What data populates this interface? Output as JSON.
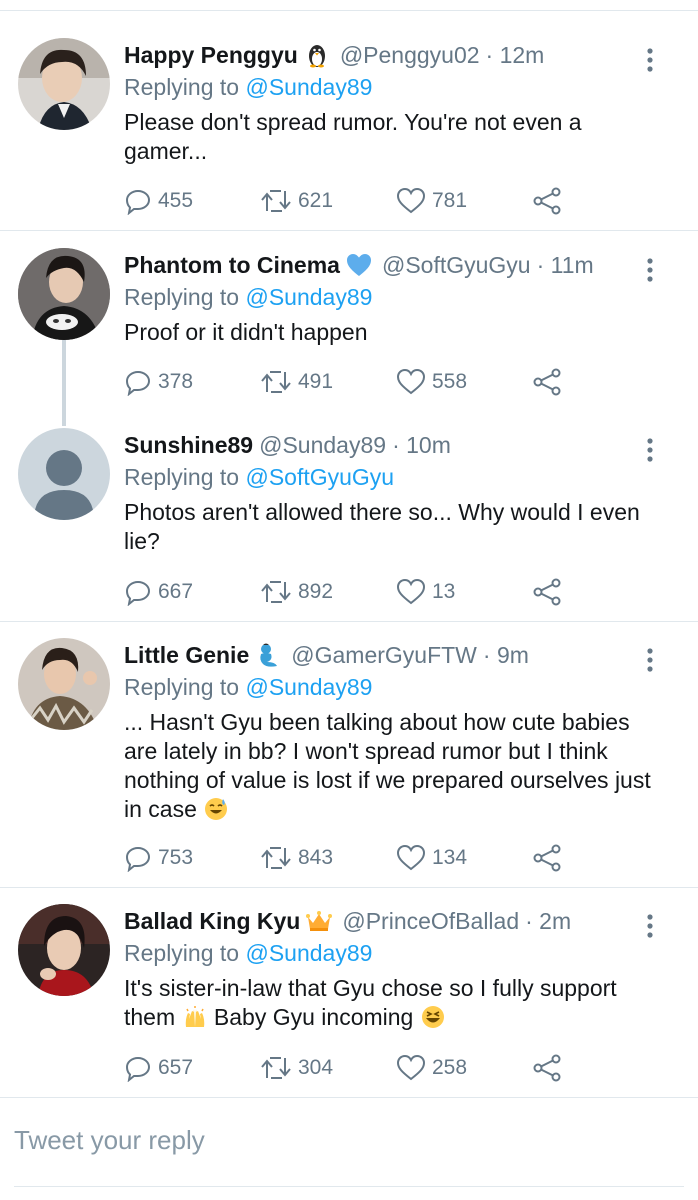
{
  "colors": {
    "accent": "#1da1f2",
    "secondary_text": "#657786",
    "primary_text": "#14171a",
    "divider": "#e1e8ed",
    "thread_line": "#ccd6dd"
  },
  "tweets": [
    {
      "display_name": "Happy Penggyu",
      "badge_icon": "penguin-emoji",
      "handle": "@Penggyu02",
      "time": "· 12m",
      "replying_prefix": "Replying to",
      "replying_to": "@Sunday89",
      "text": "Please don't spread rumor. You're not even a gamer...",
      "replies": "455",
      "retweets": "621",
      "likes": "781"
    },
    {
      "display_name": "Phantom to Cinema",
      "badge_icon": "blue-heart-emoji",
      "handle": "@SoftGyuGyu",
      "time": "· 11m",
      "replying_prefix": "Replying to",
      "replying_to": "@Sunday89",
      "text": "Proof or it didn't happen",
      "replies": "378",
      "retweets": "491",
      "likes": "558"
    },
    {
      "display_name": "Sunshine89",
      "badge_icon": "",
      "handle": "@Sunday89",
      "time": "· 10m",
      "replying_prefix": "Replying to",
      "replying_to": "@SoftGyuGyu",
      "text": "Photos aren't allowed there so... Why would I even lie?",
      "replies": "667",
      "retweets": "892",
      "likes": "13"
    },
    {
      "display_name": "Little Genie",
      "badge_icon": "genie-emoji",
      "handle": "@GamerGyuFTW",
      "time": "· 9m",
      "replying_prefix": "Replying to",
      "replying_to": "@Sunday89",
      "text": "... Hasn't Gyu been talking about how cute babies are lately in bb? I won't spread rumor but I think nothing of value is lost if we prepared ourselves just in case",
      "text_emoji": "sweat-smile-emoji",
      "replies": "753",
      "retweets": "843",
      "likes": "134"
    },
    {
      "display_name": "Ballad King Kyu",
      "badge_icon": "crown-emoji",
      "handle": "@PrinceOfBallad",
      "time": "· 2m",
      "replying_prefix": "Replying to",
      "replying_to": "@Sunday89",
      "text_part1": "It's sister-in-law that Gyu chose so I fully support them",
      "text_emoji1": "raising-hands-emoji",
      "text_part2": "Baby Gyu incoming",
      "text_emoji2": "laughing-emoji",
      "replies": "657",
      "retweets": "304",
      "likes": "258"
    }
  ],
  "reply_box": {
    "placeholder": "Tweet your reply"
  }
}
